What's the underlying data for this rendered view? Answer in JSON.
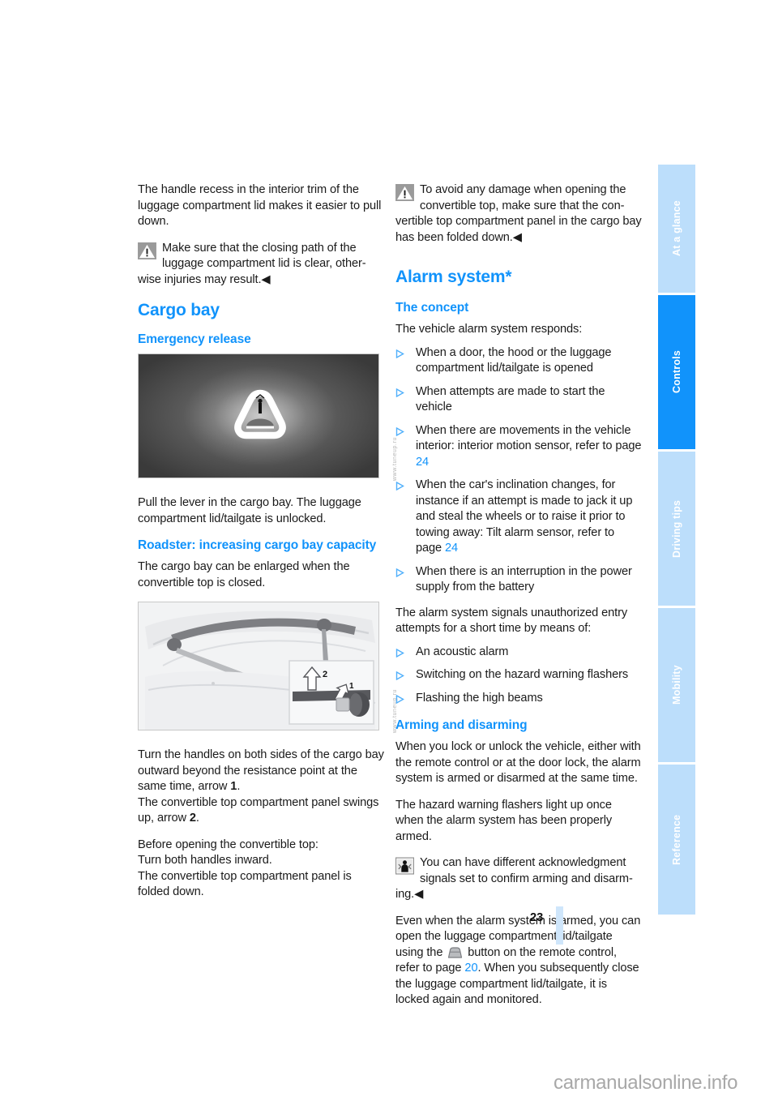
{
  "document": {
    "page_number": "23",
    "footer_watermark": "carmanualsonline.info",
    "figure_watermark": "www.tuneup.ru"
  },
  "sidebar": {
    "tabs": [
      {
        "label": "At a glance",
        "active": false
      },
      {
        "label": "Controls",
        "active": true
      },
      {
        "label": "Driving tips",
        "active": false
      },
      {
        "label": "Mobility",
        "active": false
      },
      {
        "label": "Reference",
        "active": false
      }
    ]
  },
  "colors": {
    "accent_blue": "#1193fb",
    "tab_inactive": "#bcdefb",
    "rule_blue": "#cfe6fb"
  },
  "left_column": {
    "intro_paragraph": "The handle recess in the interior trim of the luggage compartment lid makes it easier to pull down.",
    "warning": {
      "icon": "warning-triangle-icon",
      "line1": "Make sure that the closing path of the",
      "line2": "luggage compartment lid is clear, other-",
      "line3": "wise injuries may result.◀"
    },
    "heading_cargo_bay": "Cargo bay",
    "heading_emergency_release": "Emergency release",
    "figure1_alt": "emergency-release-handle-photo",
    "paragraph_pull_lever": "Pull the lever in the cargo bay. The luggage compartment lid/tailgate is unlocked.",
    "heading_roadster": "Roadster: increasing cargo bay capacity",
    "paragraph_enlarged": "The cargo bay can be enlarged when the convertible top is closed.",
    "figure2_alt": "cargo-bay-handles-diagram",
    "paragraph_turn_handles_a": "Turn the handles on both sides of the cargo bay outward beyond the resistance point at the same time, arrow ",
    "paragraph_turn_handles_arrow1": "1",
    "paragraph_turn_handles_b": ".",
    "paragraph_panel_swings_a": "The convertible top compartment panel swings up, arrow ",
    "paragraph_panel_swings_arrow2": "2",
    "paragraph_panel_swings_b": ".",
    "paragraph_before_opening": "Before opening the convertible top:\nTurn both handles inward.\nThe convertible top compartment panel is folded down."
  },
  "right_column": {
    "warning": {
      "icon": "warning-triangle-icon",
      "line1": "To avoid any damage when opening the",
      "line2": "convertible top, make sure that the con-",
      "line3": "vertible top compartment panel in the cargo bay has been folded down.◀"
    },
    "heading_alarm_system": "Alarm system*",
    "heading_the_concept": "The concept",
    "paragraph_responds": "The vehicle alarm system responds:",
    "bullets_responds": [
      {
        "text": "When a door, the hood or the luggage compartment lid/tailgate is opened"
      },
      {
        "text": "When attempts are made to start the vehicle"
      },
      {
        "text": "When there are movements in the vehicle interior: interior motion sensor, refer to page ",
        "page_ref": "24"
      },
      {
        "text": "When the car's inclination changes, for instance if an attempt is made to jack it up and steal the wheels or to raise it prior to towing away: Tilt alarm sensor, refer to page ",
        "page_ref": "24"
      },
      {
        "text": "When there is an interruption in the power supply from the battery"
      }
    ],
    "paragraph_signals": "The alarm system signals unauthorized entry attempts for a short time by means of:",
    "bullets_signals": [
      {
        "text": "An acoustic alarm"
      },
      {
        "text": "Switching on the hazard warning flashers"
      },
      {
        "text": "Flashing the high beams"
      }
    ],
    "heading_arming": "Arming and disarming",
    "paragraph_lock_unlock": "When you lock or unlock the vehicle, either with the remote control or at the door lock, the alarm system is armed or disarmed at the same time.",
    "paragraph_hazard": "The hazard warning flashers light up once when the alarm system has been properly armed.",
    "note_acknowledgment": {
      "icon": "info-person-icon",
      "line1": "You can have different acknowledgment",
      "line2": "signals set to confirm arming and disarm-",
      "line3": "ing.◀"
    },
    "paragraph_even_when_a": "Even when the alarm system is armed, you can open the luggage compartment lid/tailgate using the ",
    "paragraph_even_when_icon": "trunk-button-icon",
    "paragraph_even_when_b": " button on the remote control, refer to page ",
    "paragraph_even_when_pageref": "20",
    "paragraph_even_when_c": ". When you subsequently close the luggage compartment lid/tailgate, it is locked again and monitored."
  }
}
